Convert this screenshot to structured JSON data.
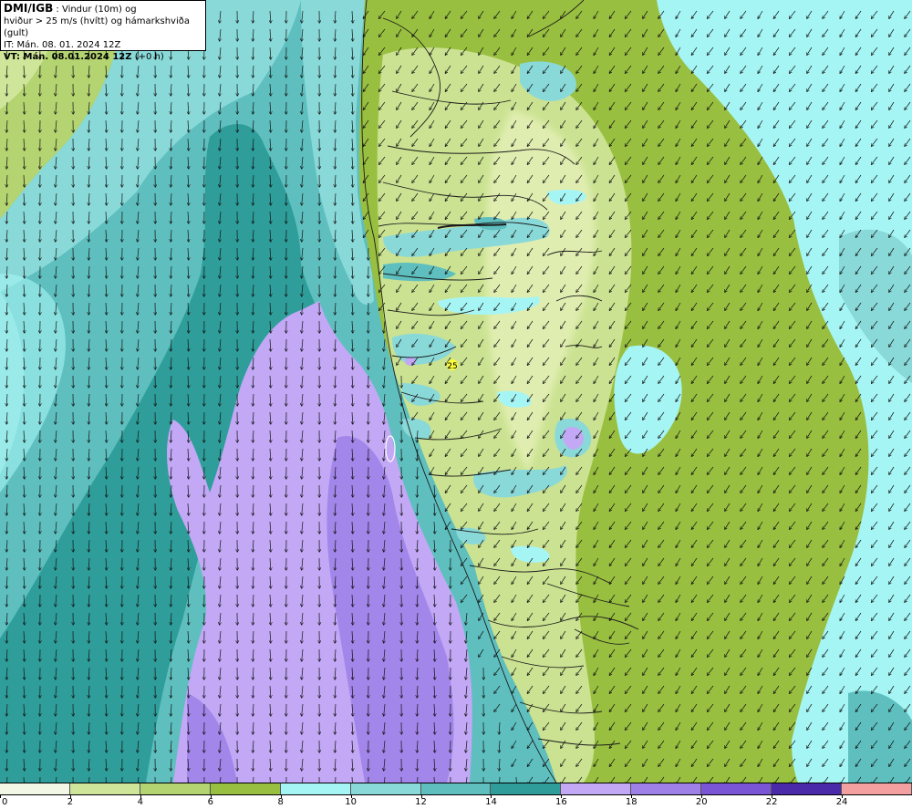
{
  "header": {
    "org": "DMI/IGB",
    "title_rest": " : Vindur (10m) og",
    "subtitle": "hviður > 25 m/s (hvítt) og hámarkshviða (gult)",
    "it_line": "IT: Mán. 08. 01. 2024 12Z",
    "vt_line": "VT: Mán. 08.01.2024 12Z",
    "vt_offset": " (+0 h)"
  },
  "max_gust_label": "25",
  "legend": {
    "ticks": [
      "0",
      "2",
      "4",
      "6",
      "8",
      "10",
      "12",
      "14",
      "16",
      "18",
      "20",
      "22",
      "24"
    ],
    "colors": [
      "#f2f7e6",
      "#cfe69a",
      "#b3d470",
      "#99bf40",
      "#a6f5f5",
      "#8ad9d9",
      "#5fbfbf",
      "#2f9e9a",
      "#c2a8f5",
      "#9e80e8",
      "#7a55d6",
      "#4a2aa8",
      "#f5a0a0"
    ]
  },
  "colors": {
    "land_light": "#e3efb4",
    "land_mid": "#b8d670",
    "land_dark": "#8db43a",
    "sea_calm": "#a6f5f5",
    "sea_mid": "#8ad9d9",
    "sea_teal": "#5fbfbf",
    "sea_dark": "#2f9e9a",
    "strong": "#c2a8f5",
    "stronger": "#9e80e8",
    "gust_marker": "#ffff33"
  }
}
